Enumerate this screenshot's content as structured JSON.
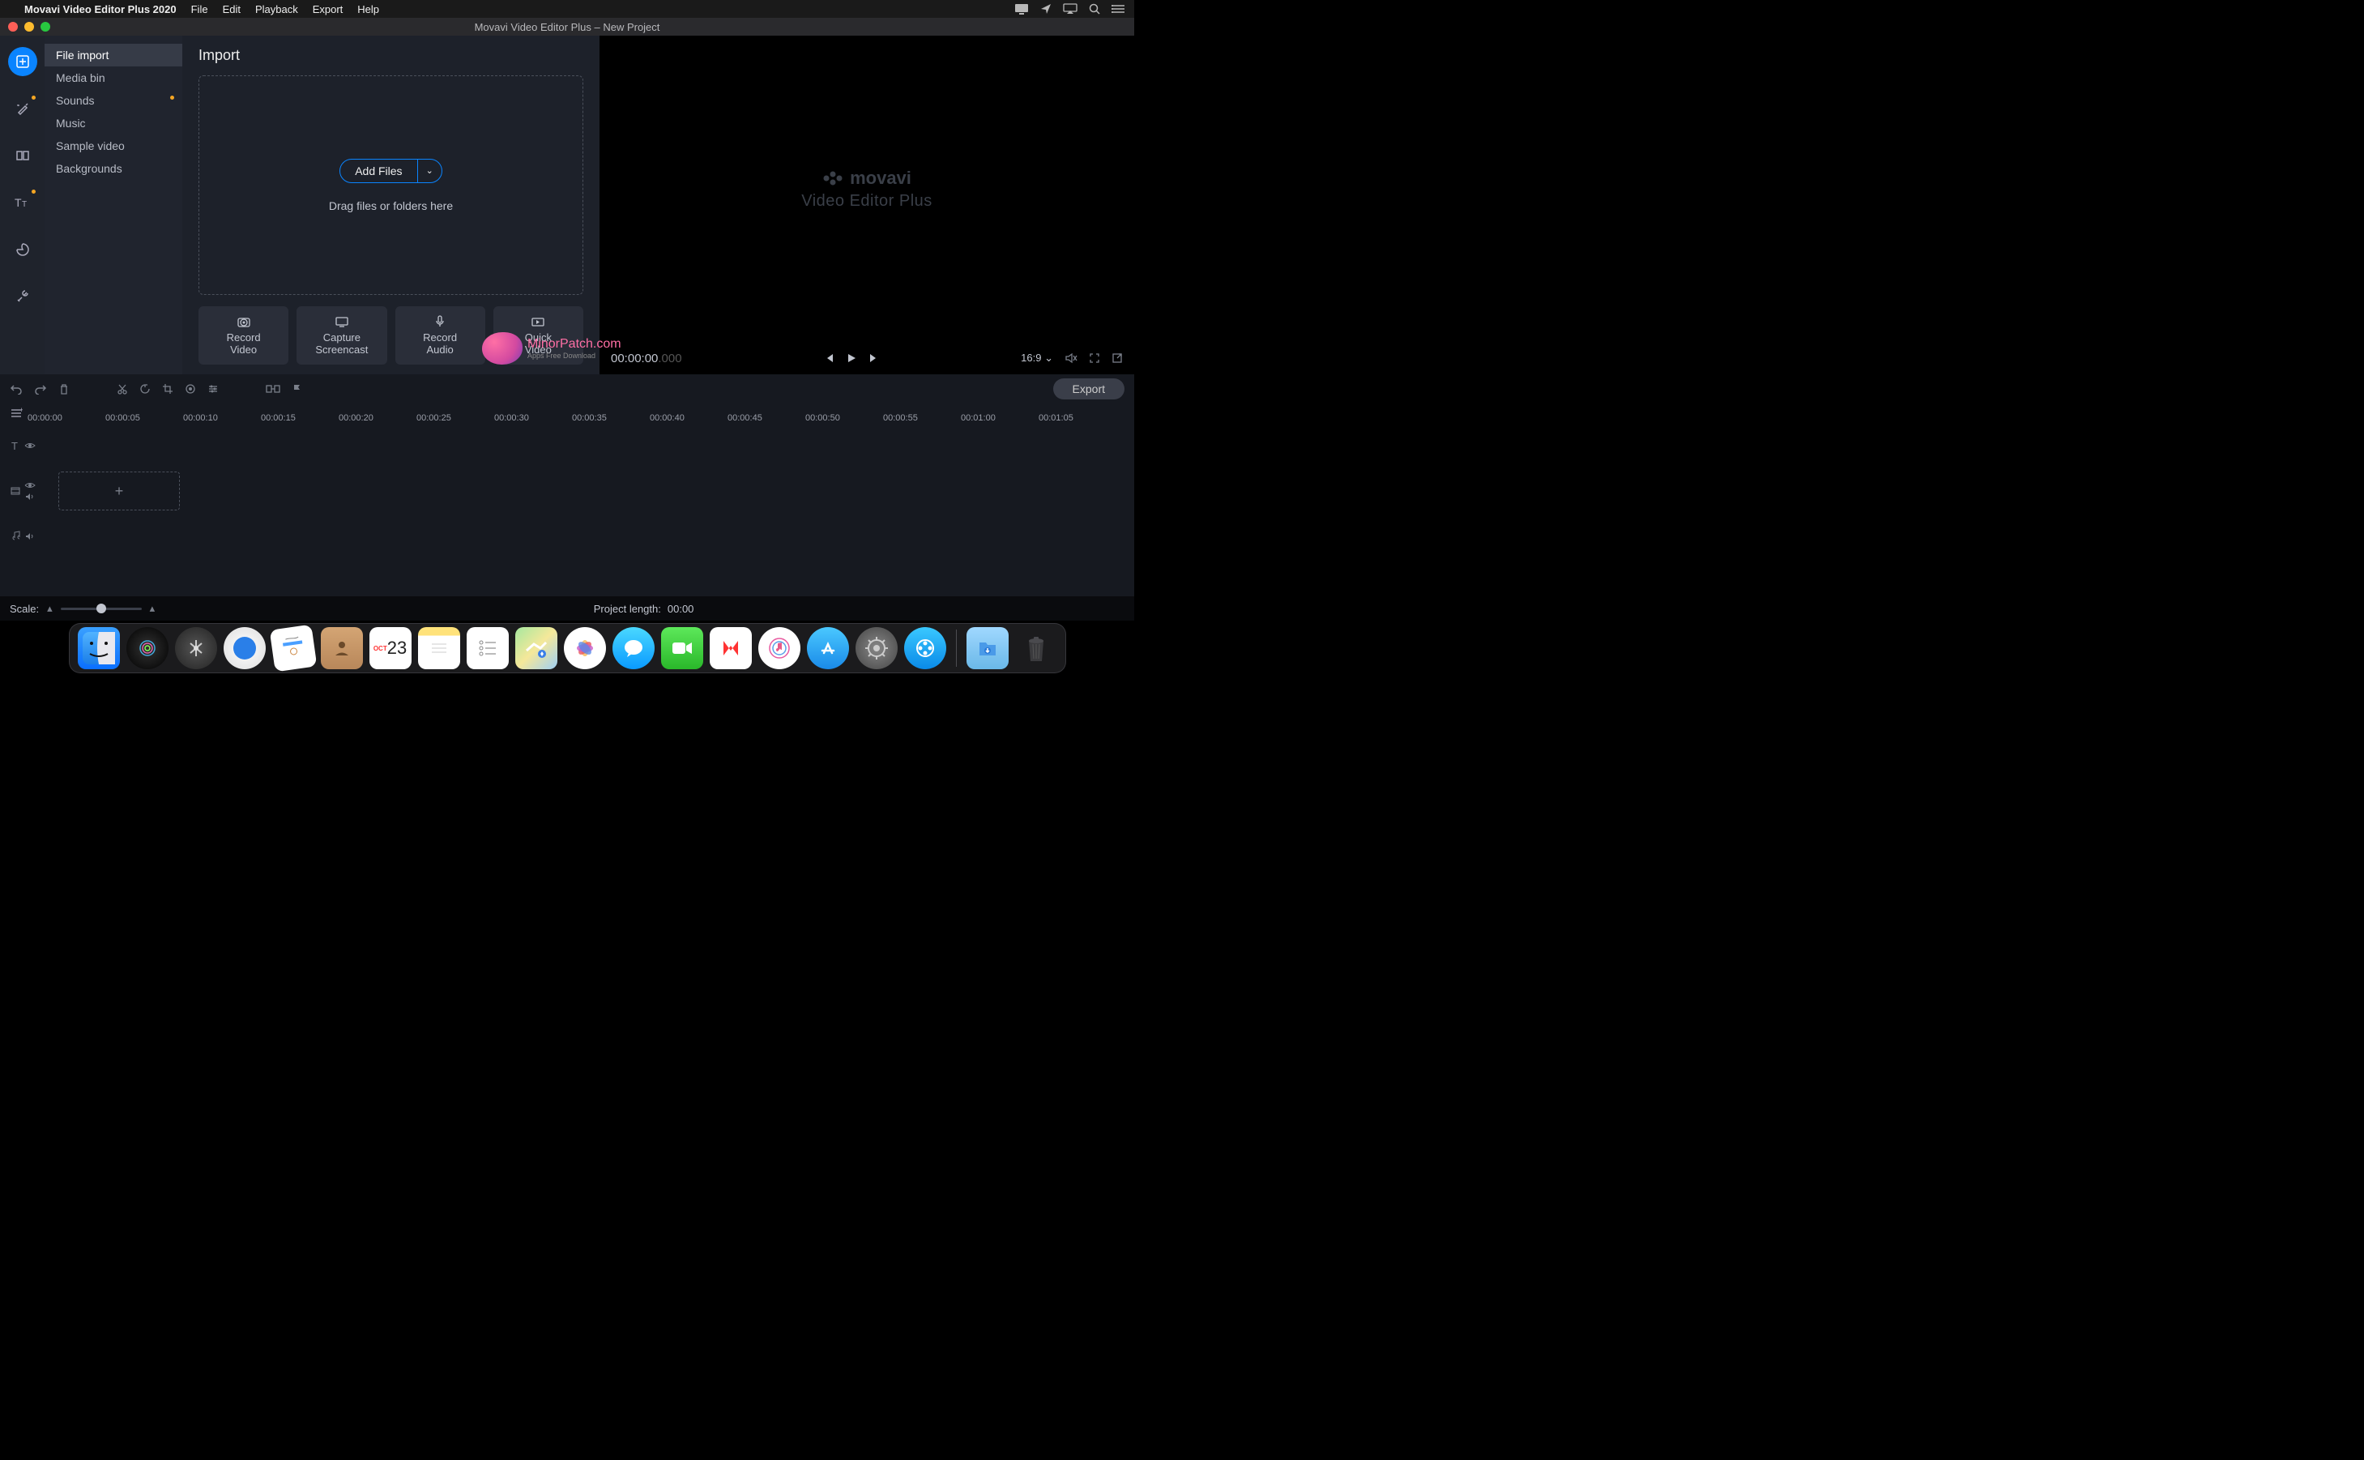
{
  "menubar": {
    "appname": "Movavi Video Editor Plus 2020",
    "items": [
      "File",
      "Edit",
      "Playback",
      "Export",
      "Help"
    ]
  },
  "window": {
    "title": "Movavi Video Editor Plus – New Project"
  },
  "sidebar": {
    "items": [
      {
        "label": "File import",
        "active": true
      },
      {
        "label": "Media bin"
      },
      {
        "label": "Sounds",
        "dot": true
      },
      {
        "label": "Music"
      },
      {
        "label": "Sample video"
      },
      {
        "label": "Backgrounds"
      }
    ]
  },
  "import": {
    "heading": "Import",
    "addfiles": "Add Files",
    "hint": "Drag files or folders here",
    "cards": [
      {
        "line1": "Record",
        "line2": "Video"
      },
      {
        "line1": "Capture",
        "line2": "Screencast"
      },
      {
        "line1": "Record",
        "line2": "Audio"
      },
      {
        "line1": "Quick",
        "line2": "Video"
      }
    ]
  },
  "preview": {
    "brand_top": "movavi",
    "brand_sub": "Video Editor Plus",
    "time": "00:00:00",
    "time_ms": ".000",
    "aspect": "16:9"
  },
  "timeline": {
    "export": "Export",
    "ticks": [
      "00:00:00",
      "00:00:05",
      "00:00:10",
      "00:00:15",
      "00:00:20",
      "00:00:25",
      "00:00:30",
      "00:00:35",
      "00:00:40",
      "00:00:45",
      "00:00:50",
      "00:00:55",
      "00:01:00",
      "00:01:05"
    ]
  },
  "status": {
    "scale": "Scale:",
    "projlen_label": "Project length:",
    "projlen_val": "00:00"
  },
  "dock": {
    "cal_month": "OCT",
    "cal_day": "23"
  },
  "watermark": {
    "name": "MinorPatch.com",
    "sub": "Apps Free Download"
  }
}
